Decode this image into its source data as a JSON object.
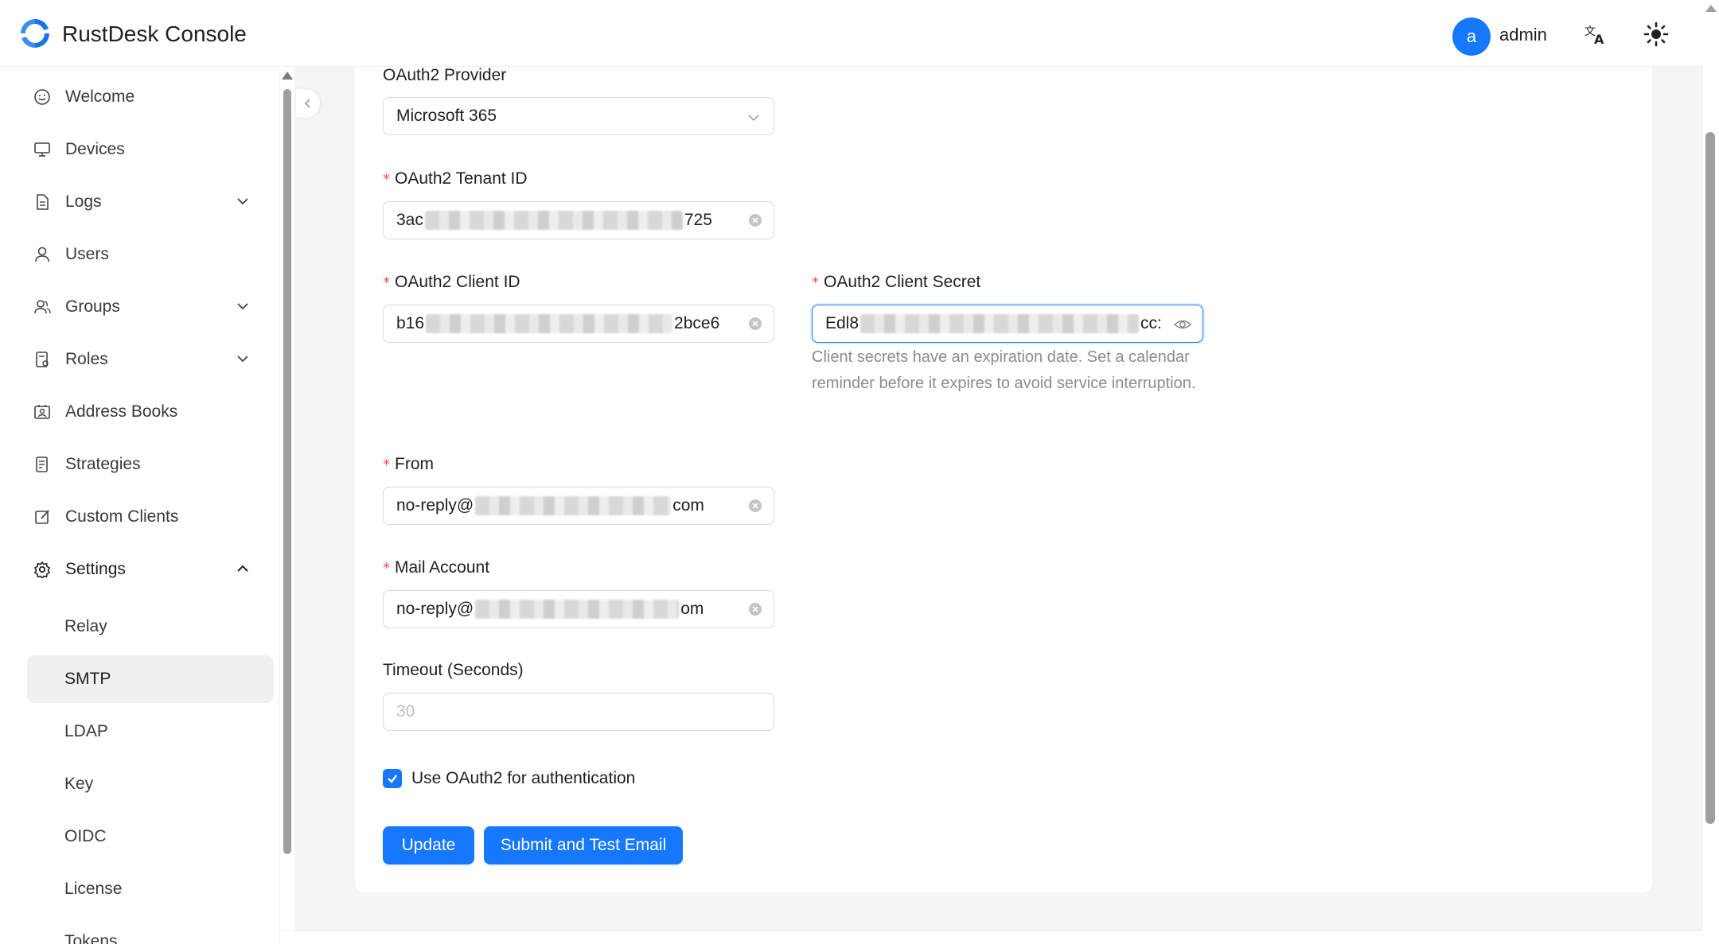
{
  "header": {
    "app_title": "RustDesk Console",
    "avatar_letter": "a",
    "username": "admin"
  },
  "sidebar": {
    "items": [
      {
        "label": "Welcome",
        "icon": "smile-icon"
      },
      {
        "label": "Devices",
        "icon": "monitor-icon"
      },
      {
        "label": "Logs",
        "icon": "file-icon",
        "expandable": true
      },
      {
        "label": "Users",
        "icon": "user-icon"
      },
      {
        "label": "Groups",
        "icon": "group-icon",
        "expandable": true
      },
      {
        "label": "Roles",
        "icon": "role-icon",
        "expandable": true
      },
      {
        "label": "Address Books",
        "icon": "contacts-icon"
      },
      {
        "label": "Strategies",
        "icon": "strategy-icon"
      },
      {
        "label": "Custom Clients",
        "icon": "edit-icon"
      },
      {
        "label": "Settings",
        "icon": "gear-icon",
        "expanded": true
      }
    ],
    "settings_sub": [
      "Relay",
      "SMTP",
      "LDAP",
      "Key",
      "OIDC",
      "License",
      "Tokens"
    ],
    "active_sub": "SMTP"
  },
  "form": {
    "provider": {
      "label": "OAuth2 Provider",
      "value": "Microsoft 365"
    },
    "tenant_id": {
      "label": "OAuth2 Tenant ID",
      "value_start": "3ac",
      "value_end": "725"
    },
    "client_id": {
      "label": "OAuth2 Client ID",
      "value_start": "b16",
      "value_end": "2bce6"
    },
    "client_secret": {
      "label": "OAuth2 Client Secret",
      "value_start": "Edl8",
      "value_end": "cc:",
      "help": "Client secrets have an expiration date. Set a calendar reminder before it expires to avoid service interruption."
    },
    "from": {
      "label": "From",
      "value_start": "no-reply@",
      "value_end": "com"
    },
    "mail_account": {
      "label": "Mail Account",
      "value_start": "no-reply@",
      "value_end": "om"
    },
    "timeout": {
      "label": "Timeout (Seconds)",
      "placeholder": "30"
    },
    "use_oauth2": {
      "label": "Use OAuth2 for authentication",
      "checked": true
    },
    "buttons": {
      "update": "Update",
      "submit_test": "Submit and Test Email"
    }
  },
  "colors": {
    "primary": "#1677ff",
    "required": "#ff4d4f"
  }
}
